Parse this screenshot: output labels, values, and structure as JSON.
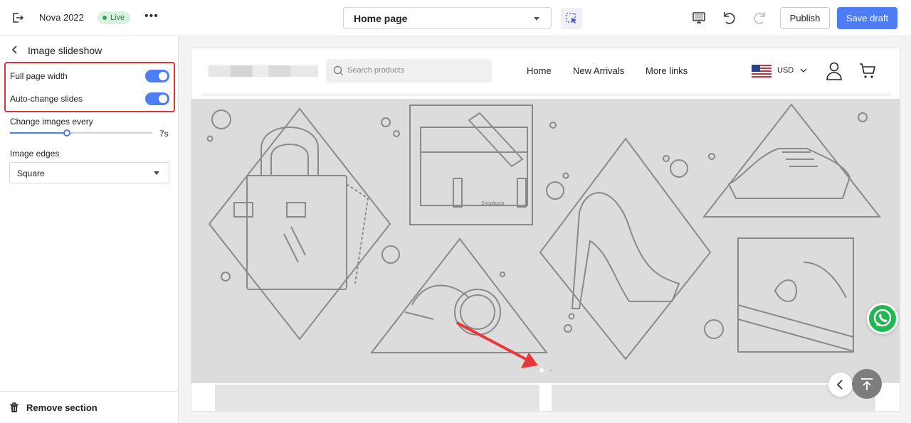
{
  "topbar": {
    "store_name": "Nova 2022",
    "status_badge": "Live",
    "page_select": "Home page",
    "publish_label": "Publish",
    "save_label": "Save draft",
    "accent_color": "#4d7cf5"
  },
  "sidebar": {
    "title": "Image slideshow",
    "full_width_label": "Full page width",
    "full_width_on": true,
    "auto_change_label": "Auto-change slides",
    "auto_change_on": true,
    "interval_label": "Change images every",
    "interval_value": "7s",
    "interval_fraction": 0.4,
    "edges_label": "Image edges",
    "edges_value": "Square",
    "remove_label": "Remove section"
  },
  "preview": {
    "search_placeholder": "Search products",
    "nav": [
      "Home",
      "New Arrivals",
      "More links"
    ],
    "currency": "USD",
    "slide_brand": "Shoplazza",
    "active_dot": 1,
    "dot_count": 2
  }
}
